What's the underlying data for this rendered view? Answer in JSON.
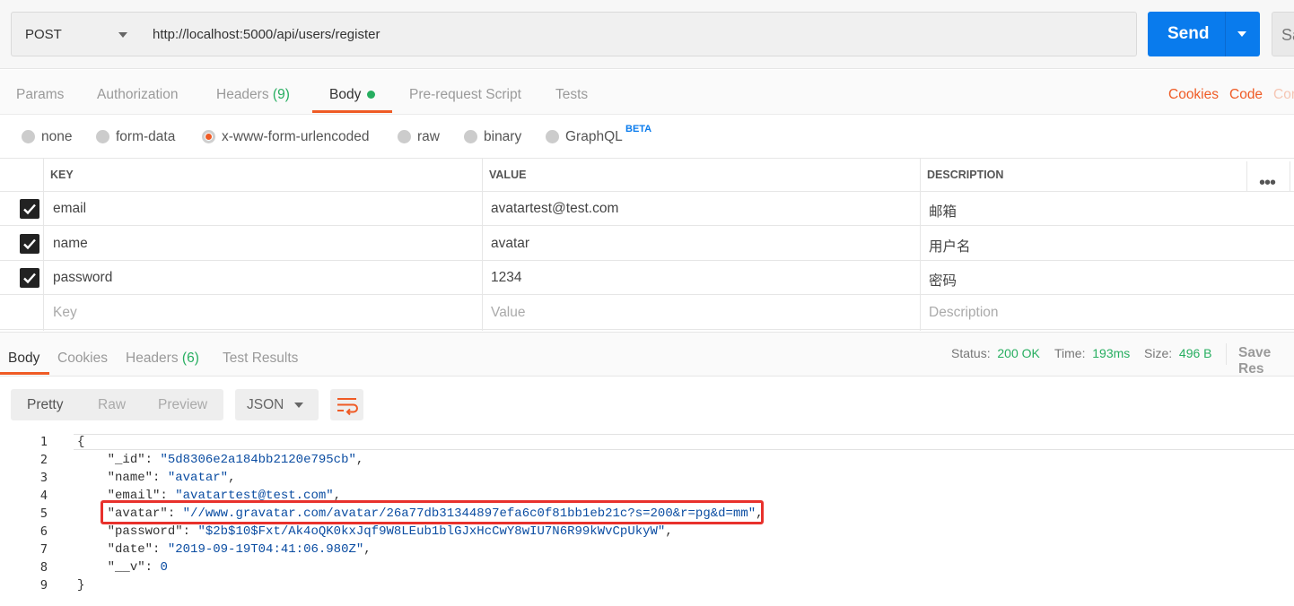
{
  "request": {
    "method": "POST",
    "url": "http://localhost:5000/api/users/register",
    "send_label": "Send",
    "save_label": "Sa"
  },
  "request_tabs": {
    "params": "Params",
    "authorization": "Authorization",
    "headers": "Headers",
    "headers_count": "(9)",
    "body": "Body",
    "prerequest": "Pre-request Script",
    "tests": "Tests",
    "cookies": "Cookies",
    "code": "Code",
    "comments": "Cor"
  },
  "body_types": {
    "none": "none",
    "form_data": "form-data",
    "urlencoded": "x-www-form-urlencoded",
    "raw": "raw",
    "binary": "binary",
    "graphql": "GraphQL",
    "beta": "BETA",
    "selected": "x-www-form-urlencoded"
  },
  "params_table": {
    "headers": {
      "key": "KEY",
      "value": "VALUE",
      "description": "DESCRIPTION",
      "more": "•••"
    },
    "rows": [
      {
        "checked": true,
        "key": "email",
        "value": "avatartest@test.com",
        "description": "邮箱"
      },
      {
        "checked": true,
        "key": "name",
        "value": "avatar",
        "description": "用户名"
      },
      {
        "checked": true,
        "key": "password",
        "value": "1234",
        "description": "密码"
      }
    ],
    "placeholder": {
      "key": "Key",
      "value": "Value",
      "description": "Description"
    }
  },
  "response_tabs": {
    "body": "Body",
    "cookies": "Cookies",
    "headers": "Headers",
    "headers_count": "(6)",
    "test_results": "Test Results"
  },
  "response_status": {
    "status_label": "Status:",
    "status_value": "200 OK",
    "time_label": "Time:",
    "time_value": "193ms",
    "size_label": "Size:",
    "size_value": "496 B",
    "save_response": "Save Res"
  },
  "viewer": {
    "pretty": "Pretty",
    "raw": "Raw",
    "preview": "Preview",
    "format": "JSON"
  },
  "code_lines": {
    "l1": {
      "num": "1",
      "open": "{"
    },
    "l2": {
      "num": "2",
      "key": "\"_id\"",
      "sep": ": ",
      "val": "\"5d8306e2a184bb2120e795cb\"",
      "end": ","
    },
    "l3": {
      "num": "3",
      "key": "\"name\"",
      "sep": ": ",
      "val": "\"avatar\"",
      "end": ","
    },
    "l4": {
      "num": "4",
      "key": "\"email\"",
      "sep": ": ",
      "val": "\"avatartest@test.com\"",
      "end": ","
    },
    "l5": {
      "num": "5",
      "key": "\"avatar\"",
      "sep": ": ",
      "val": "\"//www.gravatar.com/avatar/26a77db31344897efa6c0f81bb1eb21c?s=200&r=pg&d=mm\"",
      "end": ","
    },
    "l6": {
      "num": "6",
      "key": "\"password\"",
      "sep": ": ",
      "val": "\"$2b$10$Fxt/Ak4oQK0kxJqf9W8LEub1blGJxHcCwY8wIU7N6R99kWvCpUkyW\"",
      "end": ","
    },
    "l7": {
      "num": "7",
      "key": "\"date\"",
      "sep": ": ",
      "val": "\"2019-09-19T04:41:06.980Z\"",
      "end": ","
    },
    "l8": {
      "num": "8",
      "key": "\"__v\"",
      "sep": ": ",
      "val": "0",
      "end": ""
    },
    "l9": {
      "num": "9",
      "close": "}"
    }
  },
  "colors": {
    "accent": "#ef5b25",
    "send_button": "#097bed",
    "success": "#27ae60",
    "highlight_box": "#e8312c"
  }
}
